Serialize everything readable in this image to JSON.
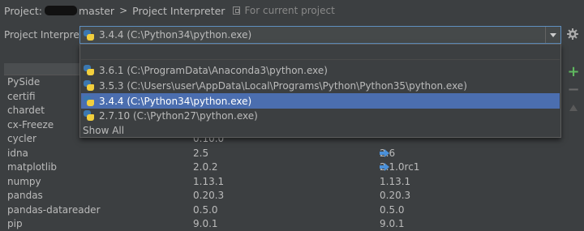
{
  "breadcrumb": {
    "project_prefix": "Project:",
    "project_suffix": "master",
    "separator": ">",
    "current": "Project Interpreter",
    "scope_note": "For current project"
  },
  "interpreter": {
    "label": "Project Interpreter:",
    "selected": "3.4.4 (C:\\Python34\\python.exe)"
  },
  "dropdown": {
    "items": [
      {
        "label": "3.6.1 (C:\\ProgramData\\Anaconda3\\python.exe)",
        "selected": false
      },
      {
        "label": "3.5.3 (C:\\Users\\user\\AppData\\Local\\Programs\\Python\\Python35\\python.exe)",
        "selected": false
      },
      {
        "label": "3.4.4 (C:\\Python34\\python.exe)",
        "selected": true
      },
      {
        "label": "2.7.10 (C:\\Python27\\python.exe)",
        "selected": false
      }
    ],
    "show_all": "Show All"
  },
  "packages": {
    "rows": [
      {
        "name": "PySide",
        "version": "",
        "latest": "",
        "upgrade": false
      },
      {
        "name": "certifi",
        "version": "",
        "latest": "",
        "upgrade": false
      },
      {
        "name": "chardet",
        "version": "",
        "latest": "",
        "upgrade": false
      },
      {
        "name": "cx-Freeze",
        "version": "",
        "latest": "",
        "upgrade": false
      },
      {
        "name": "cycler",
        "version": "0.10.0",
        "latest": "",
        "upgrade": false
      },
      {
        "name": "idna",
        "version": "2.5",
        "latest": "2.6",
        "upgrade": true
      },
      {
        "name": "matplotlib",
        "version": "2.0.2",
        "latest": "2.1.0rc1",
        "upgrade": true
      },
      {
        "name": "numpy",
        "version": "1.13.1",
        "latest": "1.13.1",
        "upgrade": false
      },
      {
        "name": "pandas",
        "version": "0.20.3",
        "latest": "0.20.3",
        "upgrade": false
      },
      {
        "name": "pandas-datareader",
        "version": "0.5.0",
        "latest": "0.5.0",
        "upgrade": false
      },
      {
        "name": "pip",
        "version": "9.0.1",
        "latest": "9.0.1",
        "upgrade": false
      }
    ]
  },
  "toolbar": {
    "add_icon": "plus-icon",
    "remove_icon": "minus-icon",
    "upgrade_icon": "upgrade-arrow-icon"
  },
  "colors": {
    "background": "#3c3f41",
    "selection": "#4b6eaf",
    "upgrade_arrow": "#4a90d9",
    "add_button": "#5fb85f"
  }
}
